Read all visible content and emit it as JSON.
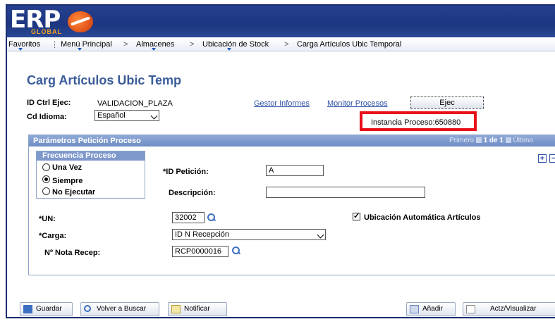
{
  "logo": {
    "main": "ERP",
    "sub": "GLOBAL"
  },
  "breadcrumb": {
    "items": [
      "Favoritos",
      "Menú Principal",
      "Almacenes",
      "Ubicación de Stock",
      "Carga Artículos Ubic Temporal"
    ],
    "separator": ">"
  },
  "page": {
    "title": "Carg Artículos Ubic Temp"
  },
  "header_fields": {
    "id_ctrl_label": "ID Ctrl Ejec:",
    "id_ctrl_value": "VALIDACION_PLAZA",
    "cd_idioma_label": "Cd Idioma:",
    "cd_idioma_value": "Español",
    "gestor_link": "Gestor Informes",
    "monitor_link": "Monitor Procesos",
    "ejec_button": "Ejec",
    "instancia": "Instancia Proceso:650880"
  },
  "panel": {
    "title": "Parámetros Petición Proceso",
    "nav_first": "Primero",
    "nav_count": "1 de 1",
    "nav_last": "Último",
    "add": "+",
    "remove": "−"
  },
  "frecuencia": {
    "title": "Frecuencia Proceso",
    "options": [
      "Una Vez",
      "Siempre",
      "No Ejecutar"
    ],
    "selected": "Siempre"
  },
  "form": {
    "id_peticion_label": "*ID Petición:",
    "id_peticion_value": "A",
    "descripcion_label": "Descripción:",
    "descripcion_value": "",
    "un_label": "*UN:",
    "un_value": "32002",
    "carga_label": "*Carga:",
    "carga_value": "ID N Recepción",
    "nota_label": "Nº Nota Recep:",
    "nota_value": "RCP0000016",
    "ubicacion_label": "Ubicación Automática Artículos",
    "ubicacion_checked": "✓"
  },
  "toolbar": {
    "guardar": "Guardar",
    "volver": "Volver a Buscar",
    "notificar": "Notificar",
    "anadir": "Añadir",
    "actualizar": "Actz/Visualizar"
  },
  "colors": {
    "banner": "#1e3680",
    "title": "#3a5c99",
    "link": "#2d4fa6",
    "highlight": "#e8101a",
    "panel_header": "#7e98cc"
  }
}
